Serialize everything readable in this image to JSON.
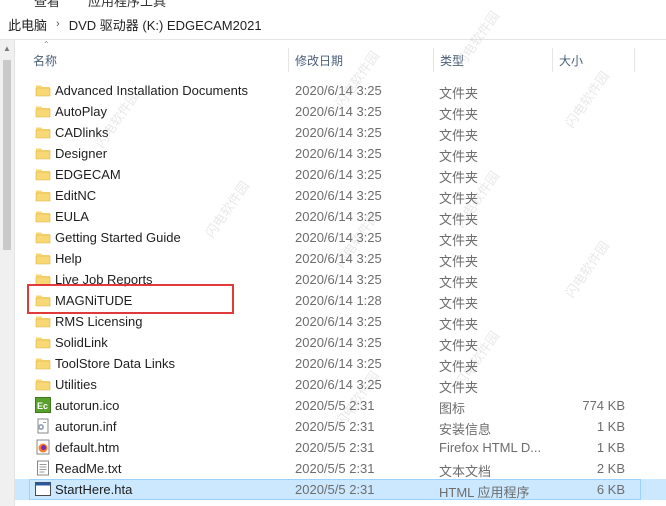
{
  "top_strip": {
    "left_fragment": "查看",
    "right_fragment": "应用程序工具"
  },
  "breadcrumb": {
    "items": [
      "此电脑",
      "DVD 驱动器 (K:) EDGECAM2021"
    ],
    "separator": "›"
  },
  "columns": {
    "name": "名称",
    "date": "修改日期",
    "type": "类型",
    "size": "大小"
  },
  "files": [
    {
      "name": "Advanced Installation Documents",
      "date": "2020/6/14 3:25",
      "type": "文件夹",
      "size": "",
      "icon": "folder-icon"
    },
    {
      "name": "AutoPlay",
      "date": "2020/6/14 3:25",
      "type": "文件夹",
      "size": "",
      "icon": "folder-icon"
    },
    {
      "name": "CADlinks",
      "date": "2020/6/14 3:25",
      "type": "文件夹",
      "size": "",
      "icon": "folder-icon"
    },
    {
      "name": "Designer",
      "date": "2020/6/14 3:25",
      "type": "文件夹",
      "size": "",
      "icon": "folder-icon"
    },
    {
      "name": "EDGECAM",
      "date": "2020/6/14 3:25",
      "type": "文件夹",
      "size": "",
      "icon": "folder-icon"
    },
    {
      "name": "EditNC",
      "date": "2020/6/14 3:25",
      "type": "文件夹",
      "size": "",
      "icon": "folder-icon"
    },
    {
      "name": "EULA",
      "date": "2020/6/14 3:25",
      "type": "文件夹",
      "size": "",
      "icon": "folder-icon"
    },
    {
      "name": "Getting Started Guide",
      "date": "2020/6/14 3:25",
      "type": "文件夹",
      "size": "",
      "icon": "folder-icon"
    },
    {
      "name": "Help",
      "date": "2020/6/14 3:25",
      "type": "文件夹",
      "size": "",
      "icon": "folder-icon"
    },
    {
      "name": "Live Job Reports",
      "date": "2020/6/14 3:25",
      "type": "文件夹",
      "size": "",
      "icon": "folder-icon"
    },
    {
      "name": "MAGNiTUDE",
      "date": "2020/6/14 1:28",
      "type": "文件夹",
      "size": "",
      "icon": "folder-icon"
    },
    {
      "name": "RMS Licensing",
      "date": "2020/6/14 3:25",
      "type": "文件夹",
      "size": "",
      "icon": "folder-icon"
    },
    {
      "name": "SolidLink",
      "date": "2020/6/14 3:25",
      "type": "文件夹",
      "size": "",
      "icon": "folder-icon"
    },
    {
      "name": "ToolStore Data Links",
      "date": "2020/6/14 3:25",
      "type": "文件夹",
      "size": "",
      "icon": "folder-icon"
    },
    {
      "name": "Utilities",
      "date": "2020/6/14 3:25",
      "type": "文件夹",
      "size": "",
      "icon": "folder-icon"
    },
    {
      "name": "autorun.ico",
      "date": "2020/5/5 2:31",
      "type": "图标",
      "size": "774 KB",
      "icon": "ec-app-icon"
    },
    {
      "name": "autorun.inf",
      "date": "2020/5/5 2:31",
      "type": "安装信息",
      "size": "1 KB",
      "icon": "setup-info-icon"
    },
    {
      "name": "default.htm",
      "date": "2020/5/5 2:31",
      "type": "Firefox HTML D...",
      "size": "1 KB",
      "icon": "firefox-html-icon"
    },
    {
      "name": "ReadMe.txt",
      "date": "2020/5/5 2:31",
      "type": "文本文档",
      "size": "2 KB",
      "icon": "text-document-icon"
    },
    {
      "name": "StartHere.hta",
      "date": "2020/5/5 2:31",
      "type": "HTML 应用程序",
      "size": "6 KB",
      "icon": "hta-app-icon",
      "selected": true
    }
  ],
  "watermark_text": "闪电软件园",
  "colors": {
    "folder": "#f8d775",
    "folder_dark": "#e0b441",
    "selection": "#cce8ff",
    "highlight_box": "#e03a3a",
    "header_text": "#4c607a"
  }
}
